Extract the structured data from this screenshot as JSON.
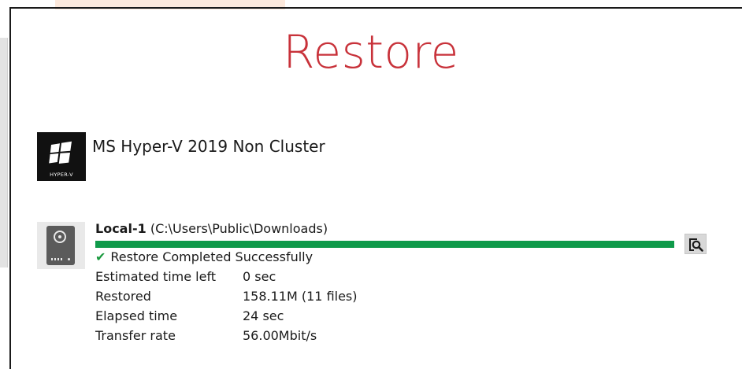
{
  "page": {
    "title": "Restore"
  },
  "backup_source": {
    "logo_text": "HYPER-V",
    "name": "MS Hyper-V 2019 Non Cluster"
  },
  "destination": {
    "name": "Local-1",
    "path": "(C:\\Users\\Public\\Downloads)",
    "progress_percent": 100,
    "progress_color": "#0f9a4a",
    "status": "Restore Completed Successfully",
    "status_color": "#1b9a3f",
    "stats": [
      {
        "label": "Estimated time left",
        "value": "0 sec"
      },
      {
        "label": "Restored",
        "value": "158.11M (11 files)"
      },
      {
        "label": "Elapsed time",
        "value": "24 sec"
      },
      {
        "label": "Transfer rate",
        "value": "56.00Mbit/s"
      }
    ]
  },
  "icons": {
    "source": "hyper-v-windows-logo-icon",
    "destination": "hard-disk-icon",
    "status": "check-icon",
    "view_log": "magnifier-document-icon"
  },
  "colors": {
    "title": "#c8323a"
  }
}
